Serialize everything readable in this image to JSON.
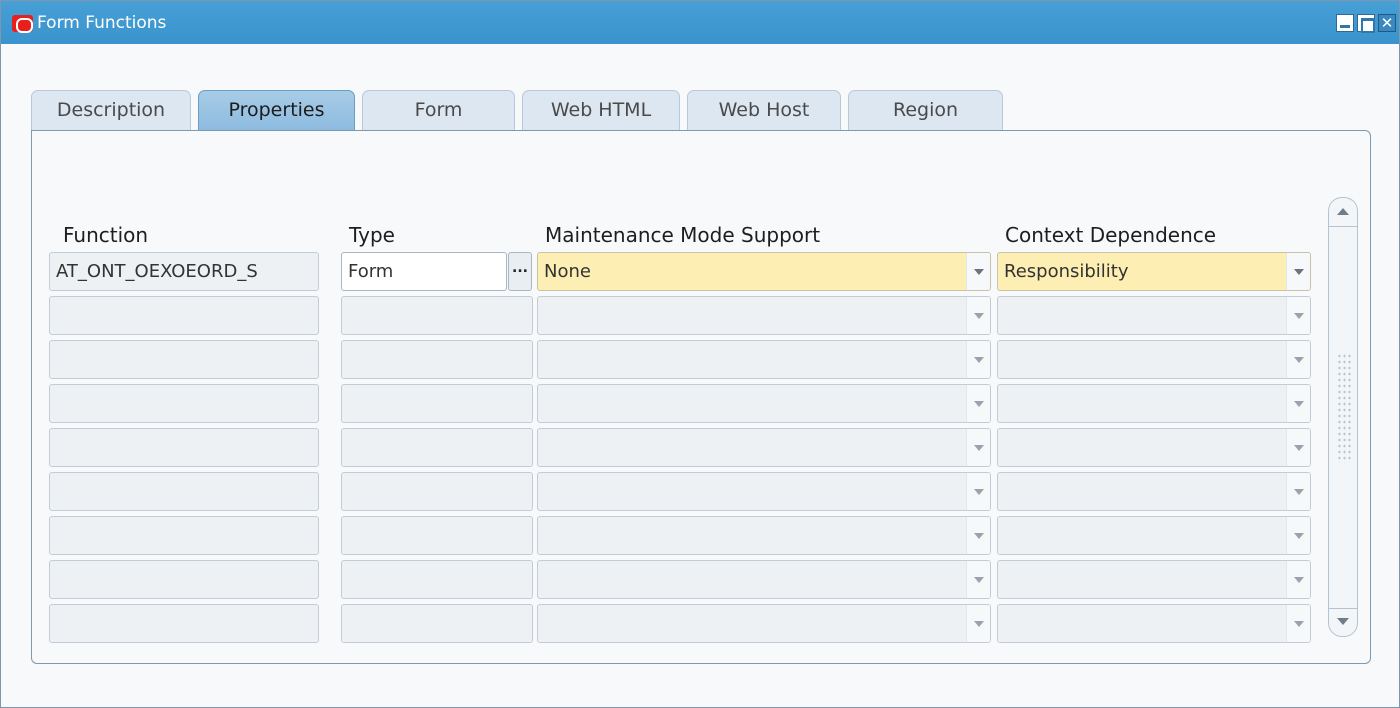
{
  "window": {
    "title": "Form Functions",
    "controls": {
      "minimize": "minimize",
      "maximize": "maximize",
      "close": "✕"
    }
  },
  "tabs": [
    {
      "label": "Description",
      "active": false
    },
    {
      "label": "Properties",
      "active": true
    },
    {
      "label": "Form",
      "active": false
    },
    {
      "label": "Web HTML",
      "active": false
    },
    {
      "label": "Web Host",
      "active": false
    },
    {
      "label": "Region",
      "active": false
    }
  ],
  "table": {
    "headers": {
      "function": "Function",
      "type": "Type",
      "maintenance": "Maintenance Mode Support",
      "context": "Context Dependence"
    },
    "rows": [
      {
        "function": "AT_ONT_OEXOEORD_S",
        "type": "Form",
        "maintenance": "None",
        "context": "Responsibility"
      },
      {
        "function": "",
        "type": "",
        "maintenance": "",
        "context": ""
      },
      {
        "function": "",
        "type": "",
        "maintenance": "",
        "context": ""
      },
      {
        "function": "",
        "type": "",
        "maintenance": "",
        "context": ""
      },
      {
        "function": "",
        "type": "",
        "maintenance": "",
        "context": ""
      },
      {
        "function": "",
        "type": "",
        "maintenance": "",
        "context": ""
      },
      {
        "function": "",
        "type": "",
        "maintenance": "",
        "context": ""
      },
      {
        "function": "",
        "type": "",
        "maintenance": "",
        "context": ""
      },
      {
        "function": "",
        "type": "",
        "maintenance": "",
        "context": ""
      }
    ],
    "lov_button": "..."
  },
  "colors": {
    "titlebar": "#3a93cc",
    "active_tab": "#8dbbe0",
    "required_field": "#fdeeb3"
  }
}
